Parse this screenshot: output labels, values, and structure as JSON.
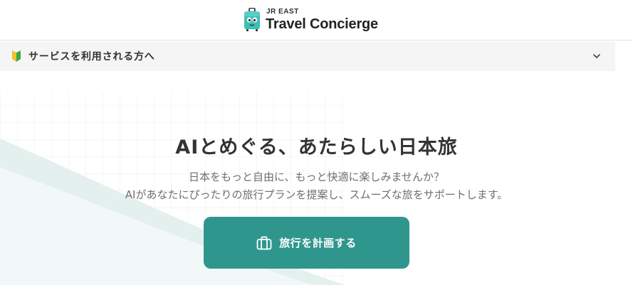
{
  "header": {
    "logo_sub": "JR EAST",
    "logo_main": "Travel Concierge"
  },
  "notice": {
    "label": "サービスを利用される方へ",
    "icon": "beginner-mark-icon",
    "toggle_icon": "chevron-down-icon"
  },
  "hero": {
    "title": "AIとめぐる、あたらしい日本旅",
    "description_line1": "日本をもっと自由に、もっと快適に楽しみませんか？",
    "description_line2": "AIがあなたにぴったりの旅行プランを提案し、スムーズな旅をサポートします。",
    "cta_label": "旅行を計画する",
    "cta_icon": "suitcase-icon"
  },
  "colors": {
    "accent": "#2f968d",
    "mascot": "#3cc0b7",
    "notice_bg": "#f5f5f5",
    "text": "#333333",
    "subtext": "#6f6f6f"
  }
}
